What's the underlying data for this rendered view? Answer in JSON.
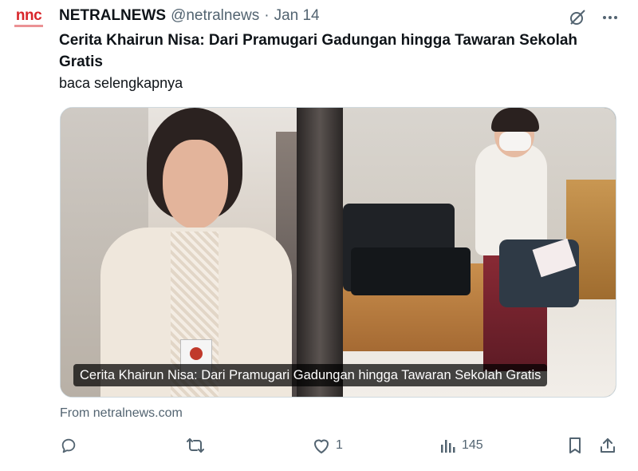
{
  "tweet": {
    "avatar": {
      "logo_text": "nnc",
      "icon": "netralnews-logo"
    },
    "author_name": "NETRALNEWS",
    "handle": "@netralnews",
    "separator": "·",
    "date": "Jan 14",
    "headline": "Cerita Khairun Nisa: Dari Pramugari Gadungan hingga Tawaran Sekolah Gratis",
    "subtext": "baca selengkapnya",
    "top_icons": [
      "grok-icon",
      "more-icon"
    ]
  },
  "card": {
    "caption": "Cerita Khairun Nisa: Dari Pramugari Gadungan hingga Tawaran Sekolah Gratis",
    "images": [
      "woman-portrait-photo",
      "woman-with-bag-photo"
    ]
  },
  "source": "From netralnews.com",
  "actions": {
    "reply": {
      "icon": "reply-icon",
      "count": ""
    },
    "retweet": {
      "icon": "retweet-icon",
      "count": ""
    },
    "like": {
      "icon": "heart-icon",
      "count": "1"
    },
    "views": {
      "icon": "views-icon",
      "count": "145"
    },
    "bookmark": {
      "icon": "bookmark-icon"
    },
    "share": {
      "icon": "share-icon"
    }
  },
  "colors": {
    "text": "#0f1419",
    "secondary": "#536471",
    "brand": "#d8262b",
    "border": "#cfd9de"
  }
}
